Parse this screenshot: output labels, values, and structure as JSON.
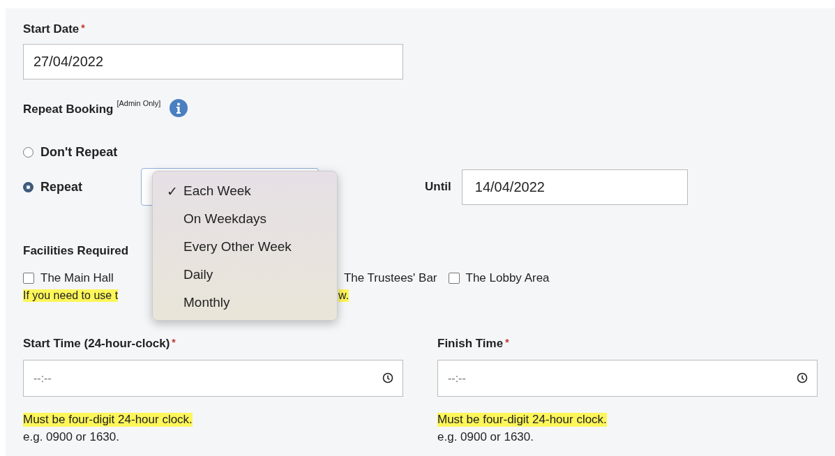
{
  "start_date": {
    "label": "Start Date",
    "required_mark": "*",
    "value": "27/04/2022"
  },
  "repeat_booking": {
    "label": "Repeat Booking",
    "note": "[Admin Only]",
    "options": [
      {
        "label": "Don't Repeat",
        "selected": false
      },
      {
        "label": "Repeat",
        "selected": true
      }
    ],
    "menu_check": "✓",
    "until_label": "Until",
    "until_value": "14/04/2022",
    "menu": [
      {
        "label": "Each Week",
        "selected": true
      },
      {
        "label": "On Weekdays",
        "selected": false
      },
      {
        "label": "Every Other Week",
        "selected": false
      },
      {
        "label": "Daily",
        "selected": false
      },
      {
        "label": "Monthly",
        "selected": false
      }
    ]
  },
  "facilities": {
    "label": "Facilities Required",
    "items": [
      {
        "label": "The Main Hall",
        "checked": false
      },
      {
        "label": "The Lobby Area",
        "checked": false
      }
    ],
    "partial_label": "The Trustees' Bar",
    "notice_start": "If you need to use t",
    "notice_end": "w."
  },
  "times": [
    {
      "label": "Start Time (24-hour-clock)",
      "required_mark": "*",
      "placeholder": "--:--",
      "hint": "Must be four-digit 24-hour clock.",
      "example": "e.g. 0900 or 1630."
    },
    {
      "label": "Finish Time",
      "required_mark": "*",
      "placeholder": "--:--",
      "hint": "Must be four-digit 24-hour clock.",
      "example": "e.g. 0900 or 1630."
    }
  ]
}
